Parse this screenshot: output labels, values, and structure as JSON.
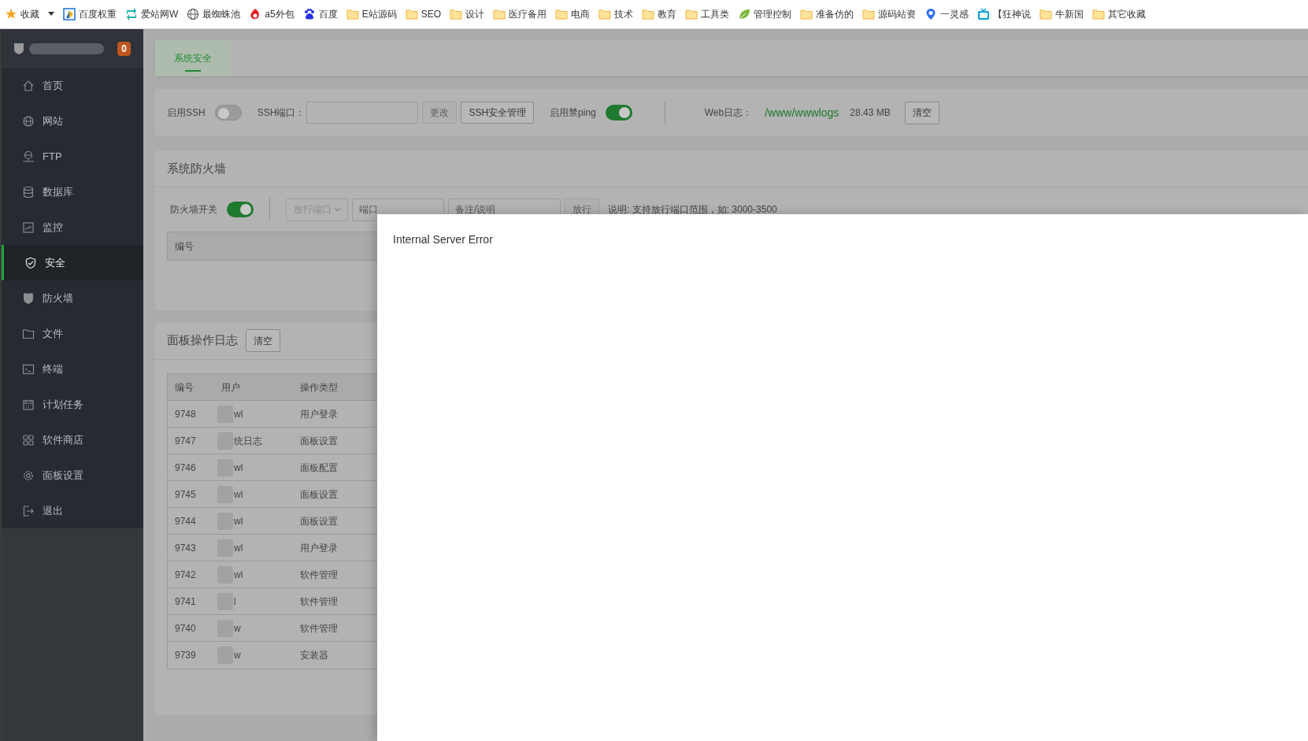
{
  "bookmarks": [
    {
      "label": "收藏",
      "kind": "star",
      "menu": true
    },
    {
      "label": "百度权重",
      "kind": "doc"
    },
    {
      "label": "爱站网W",
      "kind": "arrows"
    },
    {
      "label": "最蜘蛛池",
      "kind": "globe"
    },
    {
      "label": "a5外包",
      "kind": "mark"
    },
    {
      "label": "百度",
      "kind": "paw"
    },
    {
      "label": "E站源码",
      "kind": "folder"
    },
    {
      "label": "SEO",
      "kind": "folder"
    },
    {
      "label": "设计",
      "kind": "folder"
    },
    {
      "label": "医疗备用",
      "kind": "folder"
    },
    {
      "label": "电商",
      "kind": "folder"
    },
    {
      "label": "技术",
      "kind": "folder"
    },
    {
      "label": "教育",
      "kind": "folder"
    },
    {
      "label": "工具类",
      "kind": "folder"
    },
    {
      "label": "管理控制",
      "kind": "leaf"
    },
    {
      "label": "准备仿的",
      "kind": "folder"
    },
    {
      "label": "源码站资",
      "kind": "folder"
    },
    {
      "label": "一灵感",
      "kind": "pin"
    },
    {
      "label": "【狂神说",
      "kind": "tv"
    },
    {
      "label": "牛新国",
      "kind": "folder"
    },
    {
      "label": "其它收藏",
      "kind": "folder"
    }
  ],
  "sidebar": {
    "badge": "0",
    "items": [
      {
        "label": "首页",
        "selected": false
      },
      {
        "label": "网站",
        "selected": false
      },
      {
        "label": "FTP",
        "selected": false
      },
      {
        "label": "数据库",
        "selected": false
      },
      {
        "label": "监控",
        "selected": false
      },
      {
        "label": "安全",
        "selected": true
      },
      {
        "label": "防火墙",
        "selected": false
      },
      {
        "label": "文件",
        "selected": false
      },
      {
        "label": "终端",
        "selected": false
      },
      {
        "label": "计划任务",
        "selected": false
      },
      {
        "label": "软件商店",
        "selected": false
      },
      {
        "label": "面板设置",
        "selected": false
      },
      {
        "label": "退出",
        "selected": false
      }
    ]
  },
  "tabs": [
    {
      "label": "系统安全",
      "selected": true
    }
  ],
  "ssh": {
    "ssh_label": "启用SSH",
    "ssh_enabled": false,
    "port_label": "SSH端口：",
    "change_button": {
      "label": "更改",
      "disabled": true
    },
    "manage_button": "SSH安全管理",
    "ping_label": "启用禁ping",
    "ping_blocked": true,
    "weblog_label": "Web日志：",
    "weblog_path": "/www/wwwlogs",
    "weblog_size": "28.43 MB",
    "clear_button": "清空"
  },
  "firewall": {
    "title": "系统防火墙",
    "switch_label": "防火墙开关",
    "enabled": true,
    "rule_type": "放行端口",
    "port_placeholder": "端口",
    "note_placeholder": "备注/说明",
    "add_button": "放行",
    "hint": "说明: 支持放行端口范围，如: 3000-3500",
    "columns": [
      "编号"
    ]
  },
  "log": {
    "title": "面板操作日志",
    "clear_button": "清空",
    "columns": [
      "编号",
      "用户",
      "操作类型"
    ],
    "rows": [
      {
        "id": "9748",
        "user": "wl",
        "type": "用户登录"
      },
      {
        "id": "9747",
        "user": "统日志",
        "type": "面板设置"
      },
      {
        "id": "9746",
        "user": "wl",
        "type": "面板配置"
      },
      {
        "id": "9745",
        "user": "wl",
        "type": "面板设置"
      },
      {
        "id": "9744",
        "user": "wl",
        "type": "面板设置"
      },
      {
        "id": "9743",
        "user": "wl",
        "type": "用户登录"
      },
      {
        "id": "9742",
        "user": "wl",
        "type": "软件管理"
      },
      {
        "id": "9741",
        "user": "l",
        "type": "软件管理"
      },
      {
        "id": "9740",
        "user": "w",
        "type": "软件管理"
      },
      {
        "id": "9739",
        "user": "w",
        "type": "安装器"
      }
    ]
  },
  "modal": {
    "message": "Internal Server Error"
  }
}
